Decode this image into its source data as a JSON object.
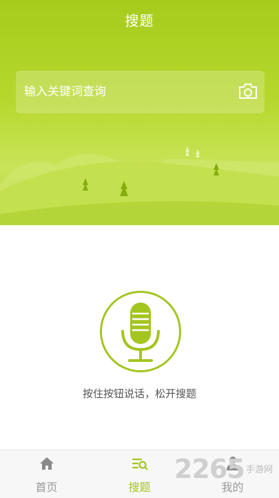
{
  "header": {
    "title": "搜题"
  },
  "search": {
    "placeholder": "输入关键词查询",
    "camera_icon": "camera-icon"
  },
  "voice": {
    "hint": "按住按钮说话，松开搜题",
    "mic_icon": "microphone-icon"
  },
  "tabs": [
    {
      "label": "首页",
      "icon": "home-icon",
      "active": false
    },
    {
      "label": "搜题",
      "icon": "search-list-icon",
      "active": true
    },
    {
      "label": "我的",
      "icon": "user-icon",
      "active": false
    }
  ],
  "watermark": {
    "number": "2265",
    "text": "手游网"
  },
  "colors": {
    "accent": "#a3c520",
    "hero_top": "#a6cc1c",
    "tab_inactive": "#999999"
  }
}
